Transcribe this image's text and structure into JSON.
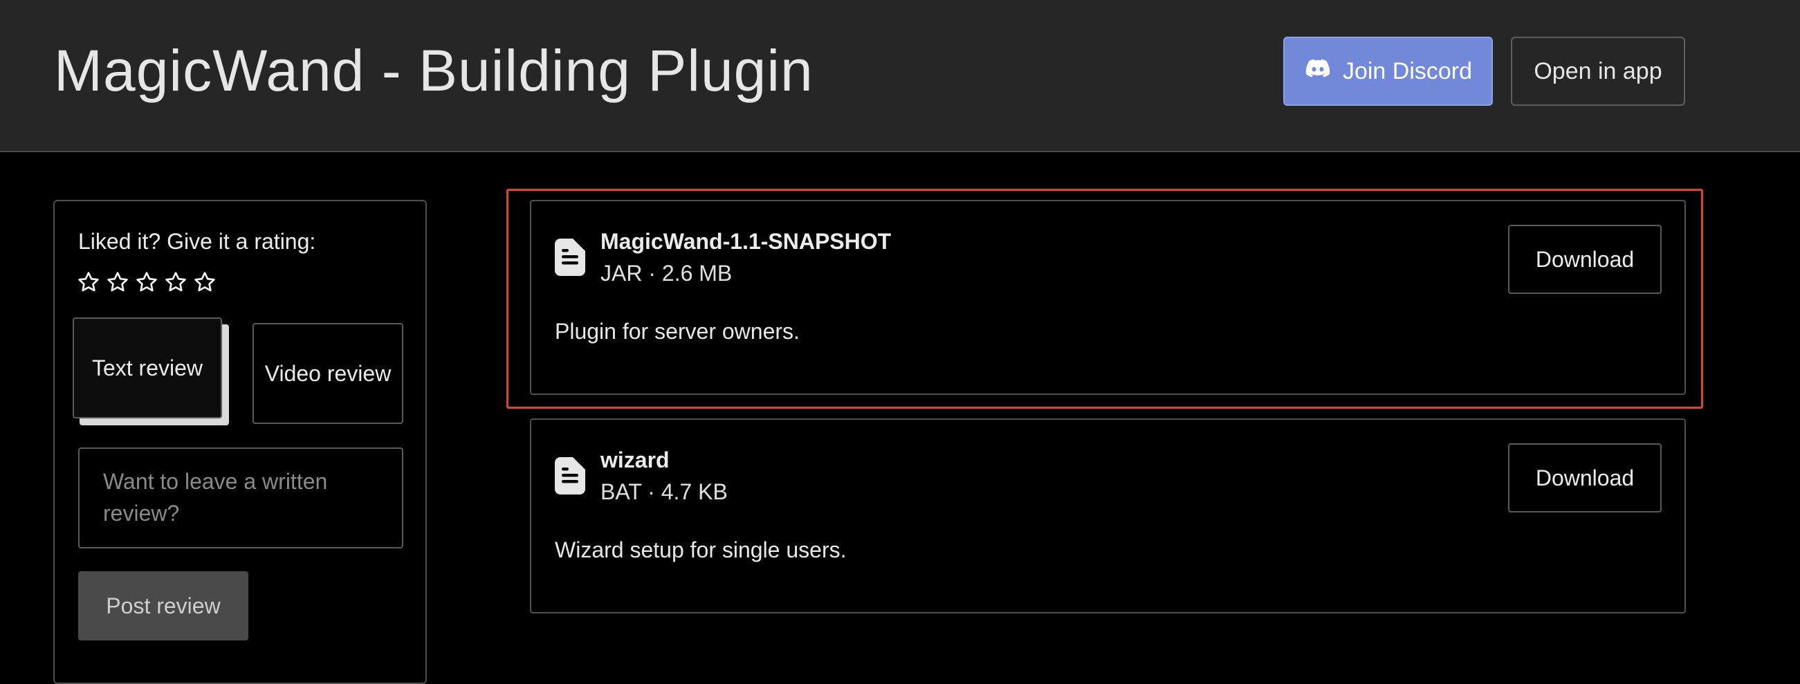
{
  "header": {
    "title": "MagicWand - Building Plugin",
    "discord_label": "Join Discord",
    "discord_icon": "discord-icon",
    "open_app_label": "Open in app"
  },
  "sidebar": {
    "rating_prompt": "Liked it? Give it a rating:",
    "stars_total": 5,
    "stars_selected": 0,
    "tabs": [
      {
        "label": "Text review",
        "active": true
      },
      {
        "label": "Video review",
        "active": false
      }
    ],
    "review_placeholder": "Want to leave a written review?",
    "review_value": "",
    "post_label": "Post review"
  },
  "files": [
    {
      "name": "MagicWand-1.1-SNAPSHOT",
      "meta": "JAR · 2.6 MB",
      "description": "Plugin for server owners.",
      "download_label": "Download",
      "highlighted": true
    },
    {
      "name": "wizard",
      "meta": "BAT · 4.7 KB",
      "description": "Wizard setup for single users.",
      "download_label": "Download",
      "highlighted": false
    }
  ],
  "colors": {
    "header_bg": "#262626",
    "page_bg": "#000000",
    "discord_accent": "#7289da",
    "highlight_border": "#d9452f"
  }
}
